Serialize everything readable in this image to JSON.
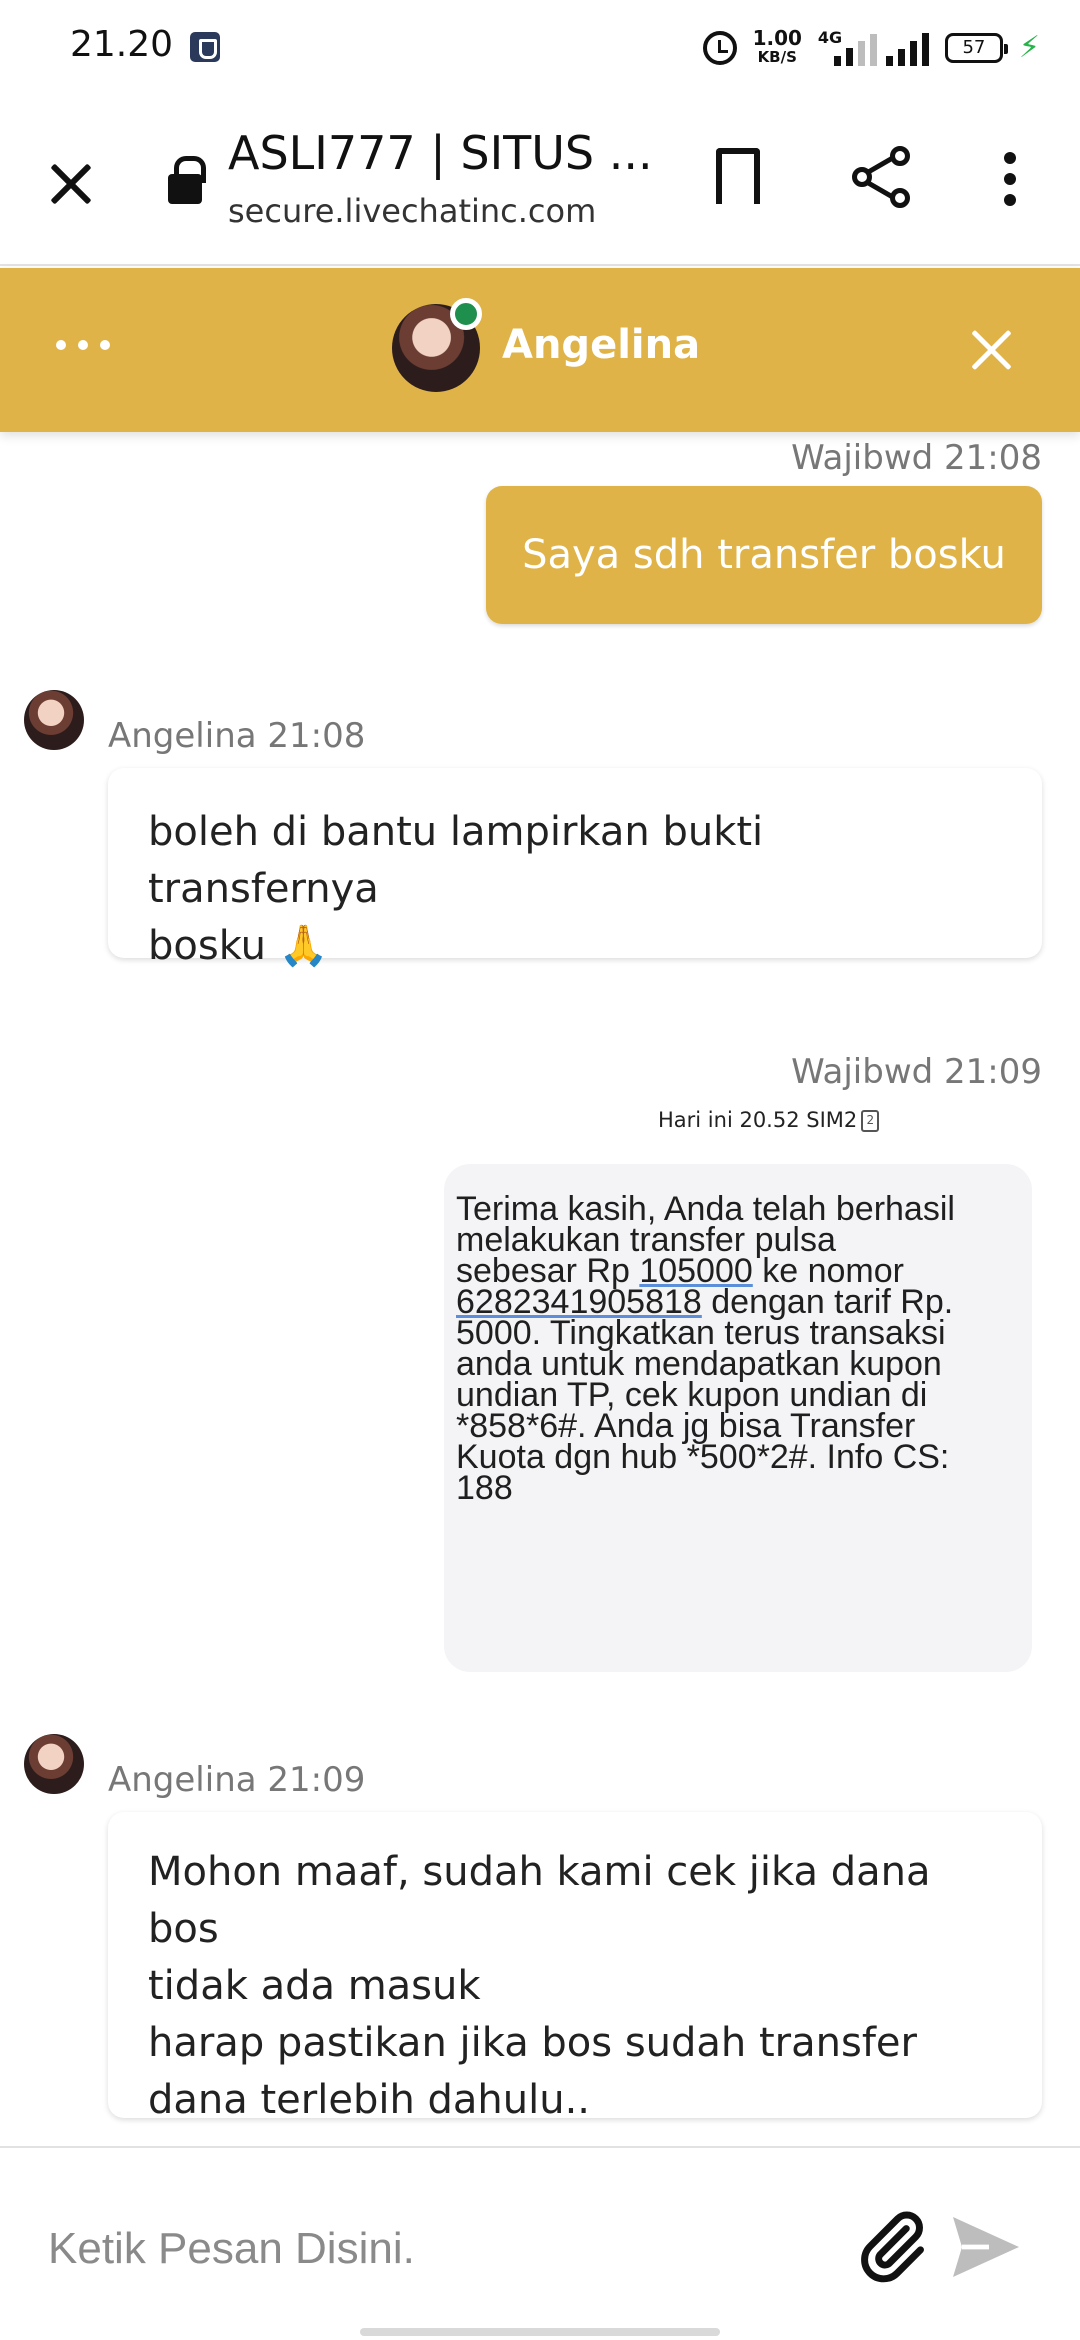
{
  "status_bar": {
    "time": "21.20",
    "net_speed_value": "1.00",
    "net_speed_unit": "KB/S",
    "network_label": "4G",
    "battery": "57"
  },
  "browser": {
    "title": "ASLI777 | SITUS ...",
    "url": "secure.livechatinc.com"
  },
  "chat_header": {
    "agent_name": "Angelina",
    "status": "online"
  },
  "messages": [
    {
      "sender": "Wajibwd",
      "time": "21:08",
      "meta": "Wajibwd 21:08",
      "text": "Saya sdh transfer bosku"
    },
    {
      "sender": "Angelina",
      "time": "21:08",
      "meta": "Angelina 21:08",
      "lines": [
        "boleh di bantu lampirkan bukti transfernya",
        "bosku"
      ],
      "emoji": "🙏"
    },
    {
      "sender": "Wajibwd",
      "time": "21:09",
      "meta": "Wajibwd 21:09",
      "attachment": {
        "header": "Hari ini 20.52  SIM2",
        "sim_badge": "2",
        "lines": [
          "Terima kasih, Anda telah berhasil",
          "melakukan transfer pulsa",
          "sebesar Rp ",
          "105000",
          " ke nomor",
          "6282341905818",
          " dengan tarif Rp.",
          "5000. Tingkatkan terus transaksi",
          "anda untuk mendapatkan kupon",
          "undian TP, cek kupon undian di",
          "*858*6#. Anda jg bisa Transfer",
          "Kuota dgn hub *500*2#. Info CS:",
          "188"
        ]
      }
    },
    {
      "sender": "Angelina",
      "time": "21:09",
      "meta": "Angelina 21:09",
      "lines": [
        "Mohon maaf, sudah kami cek jika dana bos",
        "tidak ada masuk",
        "harap pastikan jika bos sudah transfer",
        "dana terlebih dahulu.."
      ]
    }
  ],
  "composer": {
    "placeholder": "Ketik Pesan Disini."
  },
  "colors": {
    "accent": "#dfb347",
    "online": "#1f8f4e",
    "charging": "#27b24a"
  },
  "icons": [
    "close-icon",
    "lock-icon",
    "bookmark-icon",
    "share-icon",
    "more-icon",
    "alarm-icon",
    "paperclip-icon",
    "send-icon"
  ]
}
